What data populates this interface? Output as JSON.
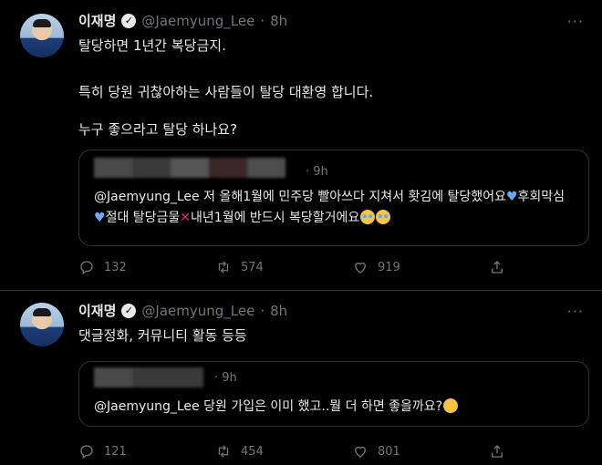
{
  "tweets": [
    {
      "name": "이재명",
      "handle": "@Jaemyung_Lee",
      "dot": "·",
      "time": "8h",
      "more": "···",
      "lines": [
        "탈당하면 1년간 복당금지.",
        "특히 당원 귀찮아하는 사람들이 탈당 대환영 합니다.",
        "누구 좋으라고 탈당 하나요?"
      ],
      "quote": {
        "time": "· 9h",
        "text_parts": {
          "p1": "@Jaemyung_Lee 저 올해1월에 민주당 빨아쓰다 지쳐서 홧김에 탈당했어요",
          "p2": "후회막심",
          "p3": "절대 탈당금물",
          "p4": "내년1월에 반드시 복당할거에요"
        }
      },
      "actions": {
        "reply": "132",
        "retweet": "574",
        "like": "919"
      }
    },
    {
      "name": "이재명",
      "handle": "@Jaemyung_Lee",
      "dot": "·",
      "time": "8h",
      "more": "···",
      "lines": [
        "댓글정화, 커뮤니티 활동 등등"
      ],
      "quote": {
        "time": "· 9h",
        "text": "@Jaemyung_Lee 당원 가입은 이미 했고..뭘 더 하면 좋을까요?"
      },
      "actions": {
        "reply": "121",
        "retweet": "454",
        "like": "801"
      }
    }
  ],
  "colors": {
    "background": "#000000",
    "text": "#e7e9ea",
    "muted": "#71767b",
    "border": "#2f3336",
    "heart": "#6da8ff",
    "cross": "#e0245e"
  }
}
